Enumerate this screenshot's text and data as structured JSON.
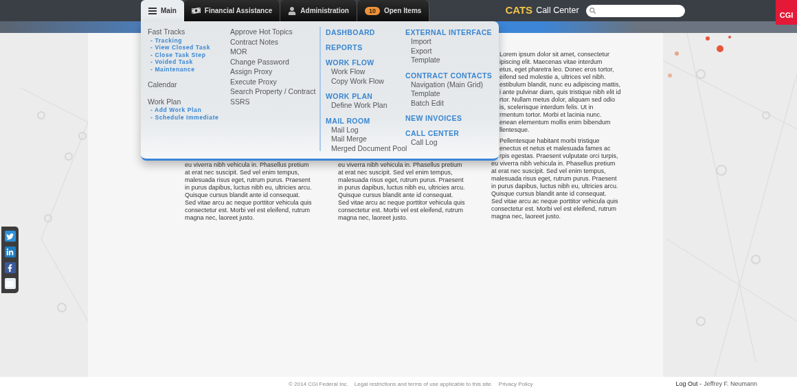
{
  "header": {
    "tabs": [
      {
        "kind": "menu",
        "label": "Main",
        "selected": true
      },
      {
        "kind": "cash",
        "label": "Financial Assistance",
        "selected": false
      },
      {
        "kind": "person",
        "label": "Administration",
        "selected": false
      },
      {
        "kind": "count",
        "label": "Open Items",
        "badge": "10",
        "selected": false
      }
    ],
    "brand": {
      "accent": "CATS",
      "title": "Call Center"
    },
    "logo": "CGI"
  },
  "menu": {
    "columns": [
      {
        "groups": [
          [
            {
              "kind": "title",
              "label": "Fast Tracks"
            },
            {
              "kind": "link",
              "label": "- Tracking"
            },
            {
              "kind": "link",
              "label": "- View Closed Task"
            },
            {
              "kind": "link",
              "label": "- Close Task Step"
            },
            {
              "kind": "link",
              "label": "- Voided Task"
            },
            {
              "kind": "link",
              "label": "- Maintenance"
            }
          ],
          [
            {
              "kind": "title",
              "label": "Calendar"
            }
          ],
          [
            {
              "kind": "title",
              "label": "Work Plan"
            },
            {
              "kind": "link",
              "label": "- Add Work Plan"
            },
            {
              "kind": "link",
              "label": "- Schedule Immediate"
            }
          ]
        ]
      },
      {
        "groups": [
          [
            {
              "kind": "title",
              "label": "Approve Hot Topics"
            },
            {
              "kind": "title",
              "label": "Contract Notes"
            },
            {
              "kind": "title",
              "label": "MOR"
            },
            {
              "kind": "title",
              "label": "Change Password"
            },
            {
              "kind": "title",
              "label": "Assign Proxy"
            },
            {
              "kind": "title",
              "label": "Execute Proxy"
            },
            {
              "kind": "title",
              "label": "Search Property / Contract"
            },
            {
              "kind": "title",
              "label": "SSRS"
            }
          ]
        ]
      },
      {
        "groups": [
          [
            {
              "kind": "heading",
              "label": "DASHBOARD"
            }
          ],
          [
            {
              "kind": "heading",
              "label": "REPORTS"
            }
          ],
          [
            {
              "kind": "heading",
              "label": "WORK FLOW"
            },
            {
              "kind": "sub",
              "label": "Work Flow"
            },
            {
              "kind": "sub",
              "label": "Copy Work Flow"
            }
          ],
          [
            {
              "kind": "heading",
              "label": "WORK PLAN"
            },
            {
              "kind": "sub",
              "label": "Define Work Plan"
            }
          ],
          [
            {
              "kind": "heading",
              "label": "MAIL ROOM"
            },
            {
              "kind": "sub",
              "label": "Mail Log"
            },
            {
              "kind": "sub",
              "label": "Mail Merge"
            },
            {
              "kind": "sub",
              "label": "Merged Document Pool"
            }
          ]
        ]
      },
      {
        "groups": [
          [
            {
              "kind": "heading",
              "label": "EXTERNAL INTERFACE"
            },
            {
              "kind": "sub",
              "label": "Import"
            },
            {
              "kind": "sub",
              "label": "Export"
            },
            {
              "kind": "sub",
              "label": "Template"
            }
          ],
          [
            {
              "kind": "heading",
              "label": "CONTRACT CONTACTS"
            },
            {
              "kind": "sub",
              "label": "Navigation (Main Grid)"
            },
            {
              "kind": "sub",
              "label": "Template"
            },
            {
              "kind": "sub",
              "label": "Batch Edit"
            }
          ],
          [
            {
              "kind": "heading",
              "label": "NEW INVOICES"
            }
          ],
          [
            {
              "kind": "heading",
              "label": "CALL CENTER"
            },
            {
              "kind": "sub",
              "label": "Call Log"
            }
          ]
        ]
      }
    ]
  },
  "content": {
    "columns": [
      {
        "paragraphs": [
          [
            "eu viverra nibh vehicula in. Phasellus pretium",
            "at erat nec suscipit. Sed vel enim tempus,",
            "malesuada risus eget, rutrum purus. Praesent",
            "in purus dapibus, luctus nibh eu, ultricies arcu.",
            "Quisque cursus blandit ante id consequat.",
            "Sed vitae arcu ac neque porttitor vehicula quis",
            "consectetur est. Morbi vel est eleifend, rutrum",
            "magna nec, laoreet justo."
          ]
        ]
      },
      {
        "paragraphs": [
          [
            "eu viverra nibh vehicula in. Phasellus pretium",
            "at erat nec suscipit. Sed vel enim tempus,",
            "malesuada risus eget, rutrum purus. Praesent",
            "in purus dapibus, luctus nibh eu, ultricies arcu.",
            "Quisque cursus blandit ante id consequat.",
            "Sed vitae arcu ac neque porttitor vehicula quis",
            "consectetur est. Morbi vel est eleifend, rutrum",
            "magna nec, laoreet justo."
          ]
        ]
      },
      {
        "paragraphs": [
          [
            "Lorem ipsum dolor sit amet, consectetur",
            "ipiscing elit. Maecenas vitae interdum",
            "etus, eget pharetra leo. Donec eros tortor,",
            "eifend sed molestie a, ultrices vel nibh.",
            "estibulum blandit, nunc eu adipiscing mattis,",
            "i ante pulvinar diam, quis tristique nibh elit id",
            "rtor. Nullam metus dolor, aliquam sed odio",
            "is, scelerisque interdum felis. Ut in",
            "rmentum tortor. Morbi et lacinia nunc.",
            "enean elementum mollis enim bibendum",
            "llentesque."
          ],
          [
            "Pellentesque habitant morbi tristique",
            "enectus et netus et malesuada fames ac",
            "rpis egestas. Praesent vulputate orci turpis,",
            "eu viverra nibh vehicula in. Phasellus pretium",
            "at erat nec suscipit. Sed vel enim tempus,",
            "malesuada risus eget, rutrum purus. Praesent",
            "in purus dapibus, luctus nibh eu, ultricies arcu.",
            "Quisque cursus blandit ante id consequat.",
            "Sed vitae arcu ac neque porttitor vehicula quis",
            "consectetur est. Morbi vel est eleifend, rutrum",
            "magna nec, laoreet justo."
          ]
        ]
      }
    ]
  },
  "social": [
    {
      "kind": "twitter"
    },
    {
      "kind": "linkedin"
    },
    {
      "kind": "facebook"
    },
    {
      "kind": "email"
    }
  ],
  "footer": {
    "copyright": "© 2014 CGI Federal Inc.",
    "legal": "Legal restrictions and terms of use applicable to this site.",
    "privacy": "Privacy Policy",
    "logout": "Log Out -",
    "user": "Jeffrey F. Neumann"
  }
}
